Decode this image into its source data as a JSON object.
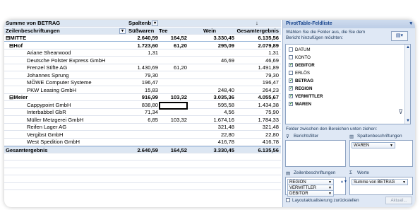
{
  "pivot": {
    "header_row1": {
      "label": "Summe von BETRAG",
      "col_header": "Spaltenb"
    },
    "header_row2": {
      "label": "Zeilenbeschriftungen",
      "c1": "Süßwaren",
      "c2": "Tee",
      "c3": "Wein",
      "c4": "Gesamtergebnis",
      "arrow": "↓"
    },
    "rows": [
      {
        "label": "⊟MITTE",
        "c1": "2.640,59",
        "c2": "164,52",
        "c3": "3.330,45",
        "c4": "6.135,56",
        "style": "section",
        "indent": 0
      },
      {
        "label": "⊟Hof",
        "c1": "1.723,60",
        "c2": "61,20",
        "c3": "295,09",
        "c4": "2.079,89",
        "style": "bold",
        "indent": 5
      },
      {
        "label": "Ariane Shearwood",
        "c1": "1,31",
        "c2": "",
        "c3": "",
        "c4": "1,31",
        "style": "",
        "indent": 30
      },
      {
        "label": "Deutsche Polster Express GmbH",
        "c1": "",
        "c2": "",
        "c3": "46,69",
        "c4": "46,69",
        "style": "",
        "indent": 30
      },
      {
        "label": "Frenzel Stifte AG",
        "c1": "1.430,69",
        "c2": "61,20",
        "c3": "",
        "c4": "1.491,89",
        "style": "",
        "indent": 30
      },
      {
        "label": "Johannes Sprung",
        "c1": "79,30",
        "c2": "",
        "c3": "",
        "c4": "79,30",
        "style": "",
        "indent": 30
      },
      {
        "label": "MÖWE Computer Systeme",
        "c1": "196,47",
        "c2": "",
        "c3": "",
        "c4": "196,47",
        "style": "",
        "indent": 30
      },
      {
        "label": "PKW Leasing GmbH",
        "c1": "15,83",
        "c2": "",
        "c3": "248,40",
        "c4": "264,23",
        "style": "",
        "indent": 30
      },
      {
        "label": "⊟Meier",
        "c1": "916,99",
        "c2": "103,32",
        "c3": "3.035,36",
        "c4": "4.055,67",
        "style": "bold",
        "indent": 5
      },
      {
        "label": "Cappypoint GmbH",
        "c1": "838,80",
        "c2": "",
        "c3": "595,58",
        "c4": "1.434,38",
        "style": "",
        "indent": 30
      },
      {
        "label": "Interbabbel GbR",
        "c1": "71,34",
        "c2": "",
        "c3": "4,56",
        "c4": "75,90",
        "style": "",
        "indent": 30
      },
      {
        "label": "Müller Metzgerei GmbH",
        "c1": "6,85",
        "c2": "103,32",
        "c3": "1.674,16",
        "c4": "1.784,33",
        "style": "",
        "indent": 30
      },
      {
        "label": "Reifen Lager AG",
        "c1": "",
        "c2": "",
        "c3": "321,48",
        "c4": "321,48",
        "style": "",
        "indent": 30
      },
      {
        "label": "Vergibst GmbH",
        "c1": "",
        "c2": "",
        "c3": "22,80",
        "c4": "22,80",
        "style": "",
        "indent": 30
      },
      {
        "label": "West Spedition GmbH",
        "c1": "",
        "c2": "",
        "c3": "416,78",
        "c4": "416,78",
        "style": "",
        "indent": 30
      }
    ],
    "total": {
      "label": "Gesamtergebnis",
      "c1": "2.640,59",
      "c2": "164,52",
      "c3": "3.330,45",
      "c4": "6.135,56"
    }
  },
  "pane": {
    "title": "PivotTable-Feldliste",
    "close_glyph": "▾",
    "hint": "Wählen Sie die Felder aus, die Sie dem Bericht hinzufügen möchten:",
    "layout_glyph": "▤▾",
    "fields": [
      {
        "name": "DATUM",
        "checked": false
      },
      {
        "name": "KONTO",
        "checked": false
      },
      {
        "name": "DEBITOR",
        "checked": true
      },
      {
        "name": "ERLÖS",
        "checked": false
      },
      {
        "name": "BETRAG",
        "checked": true
      },
      {
        "name": "REGION",
        "checked": true
      },
      {
        "name": "VERMITTLER",
        "checked": true
      },
      {
        "name": "WAREN",
        "checked": true
      }
    ],
    "areas_hint": "Felder zwischen den Bereichen unten ziehen:",
    "report_filter": "Berichtsfilter",
    "column_labels": "Spaltenbeschriftungen",
    "row_labels": "Zeilenbeschriftungen",
    "values": "Werte",
    "column_items": [
      "WAREN"
    ],
    "row_items": [
      "REGION",
      "VERMITTLER",
      "DEBITOR"
    ],
    "value_items": [
      "Summe von BETRAG"
    ],
    "defer_label": "Layoutaktualisierung zurückstellen",
    "update_label": "Aktuali..."
  }
}
